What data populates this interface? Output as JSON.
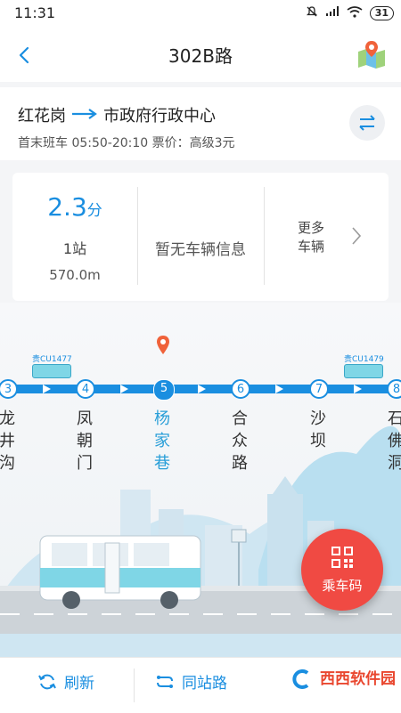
{
  "status_bar": {
    "time": "11:31",
    "battery": "31"
  },
  "header": {
    "title": "302B路"
  },
  "route": {
    "from": "红花岗",
    "to": "市政府行政中心",
    "info": "首末班车 05:50-20:10 票价：高级3元"
  },
  "arrival": {
    "eta_value": "2.3",
    "eta_unit": "分",
    "stops_away": "1站",
    "distance": "570.0m",
    "no_vehicle_text": "暂无车辆信息",
    "more_line1": "更多",
    "more_line2": "车辆"
  },
  "stations": [
    {
      "num": "3",
      "name": "龙井沟"
    },
    {
      "num": "4",
      "name": "凤朝门"
    },
    {
      "num": "5",
      "name": "杨家巷",
      "current": true
    },
    {
      "num": "6",
      "name": "合众路"
    },
    {
      "num": "7",
      "name": "沙坝"
    },
    {
      "num": "8",
      "name": "石佛洞"
    }
  ],
  "buses": [
    {
      "plate": "贵CU1477"
    },
    {
      "plate": "贵CU1479"
    }
  ],
  "colors": {
    "accent": "#1a8ee0",
    "current_station": "#2a9fd8",
    "marker": "#f0623a",
    "ride_button": "#f04a43"
  },
  "bottom": {
    "refresh": "刷新",
    "same_station": "同站路",
    "ride_code": "乘车码"
  },
  "watermark": "西西软件园"
}
